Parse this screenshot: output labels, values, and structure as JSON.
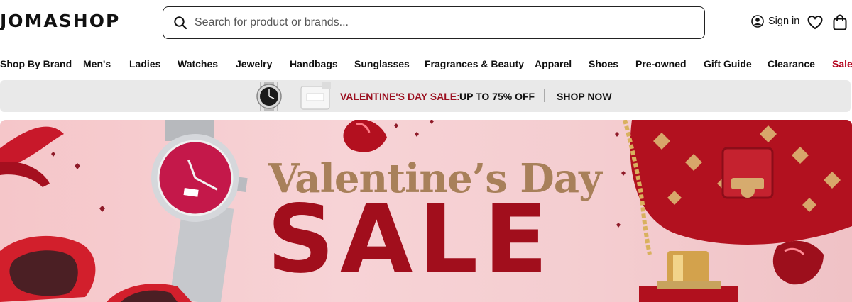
{
  "header": {
    "logo": "JOMASHOP",
    "search_placeholder": "Search for product or brands...",
    "sign_in": "Sign in"
  },
  "nav": {
    "items": [
      "Shop By Brand",
      "Men's",
      "Ladies",
      "Watches",
      "Jewelry",
      "Handbags",
      "Sunglasses",
      "Fragrances & Beauty",
      "Apparel",
      "Shoes",
      "Pre-owned",
      "Gift Guide",
      "Clearance",
      "Sale"
    ]
  },
  "promo": {
    "label": "VALENTINE'S DAY SALE:",
    "offer": "UP TO 75% OFF",
    "cta": "SHOP NOW"
  },
  "banner": {
    "headline": "Valentine’s Day",
    "sale": "SALE"
  },
  "colors": {
    "sale_red": "#b3001b",
    "promo_red": "#9b1020",
    "banner_pink": "#f7d3d6",
    "headline_gold": "#a8805a",
    "sale_word_red": "#a10e1c"
  }
}
